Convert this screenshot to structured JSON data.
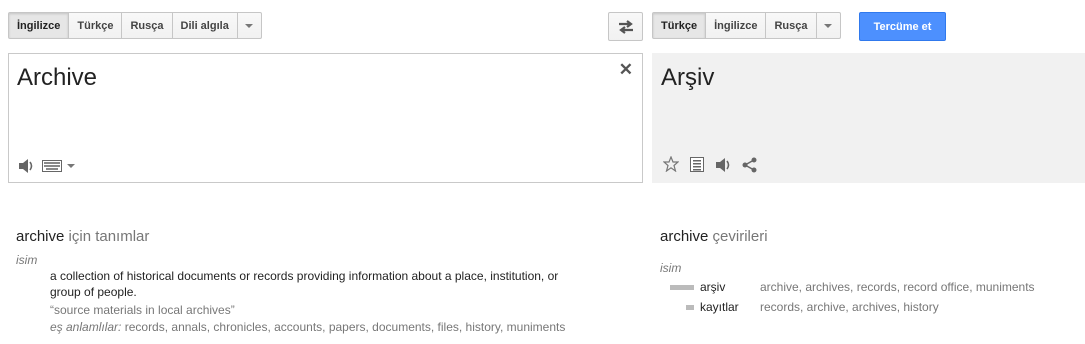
{
  "source_langs": [
    "İngilizce",
    "Türkçe",
    "Rusça",
    "Dili algıla"
  ],
  "target_langs": [
    "Türkçe",
    "İngilizce",
    "Rusça"
  ],
  "translate_label": "Tercüme et",
  "source_text": "Archive",
  "target_text": "Arşiv",
  "icons": {
    "swap": "swap-languages-icon",
    "clear": "close-icon",
    "listen": "speaker-icon",
    "keyboard": "keyboard-icon",
    "star": "star-icon",
    "phrasebook": "phrasebook-icon",
    "share": "share-icon"
  },
  "definitions": {
    "word": "archive",
    "heading_suffix": "için tanımlar",
    "pos": "isim",
    "text_line1": "a collection of historical documents or records providing information about a place, institution, or",
    "text_line2": "group of people.",
    "example": "“source materials in local archives”",
    "synonyms_label": "eş anlamlılar:",
    "synonyms": "records, annals, chronicles, accounts, papers, documents, files, history, muniments"
  },
  "translations": {
    "word": "archive",
    "heading_suffix": "çevirileri",
    "pos": "isim",
    "rows": [
      {
        "word": "arşiv",
        "synonyms": "archive, archives, records, record office, muniments",
        "frequency": 1.0
      },
      {
        "word": "kayıtlar",
        "synonyms": "records, archive, archives, history",
        "frequency": 0.33
      }
    ]
  },
  "colors": {
    "accent": "#4d90fe",
    "target_bg": "#f1f1f1"
  }
}
